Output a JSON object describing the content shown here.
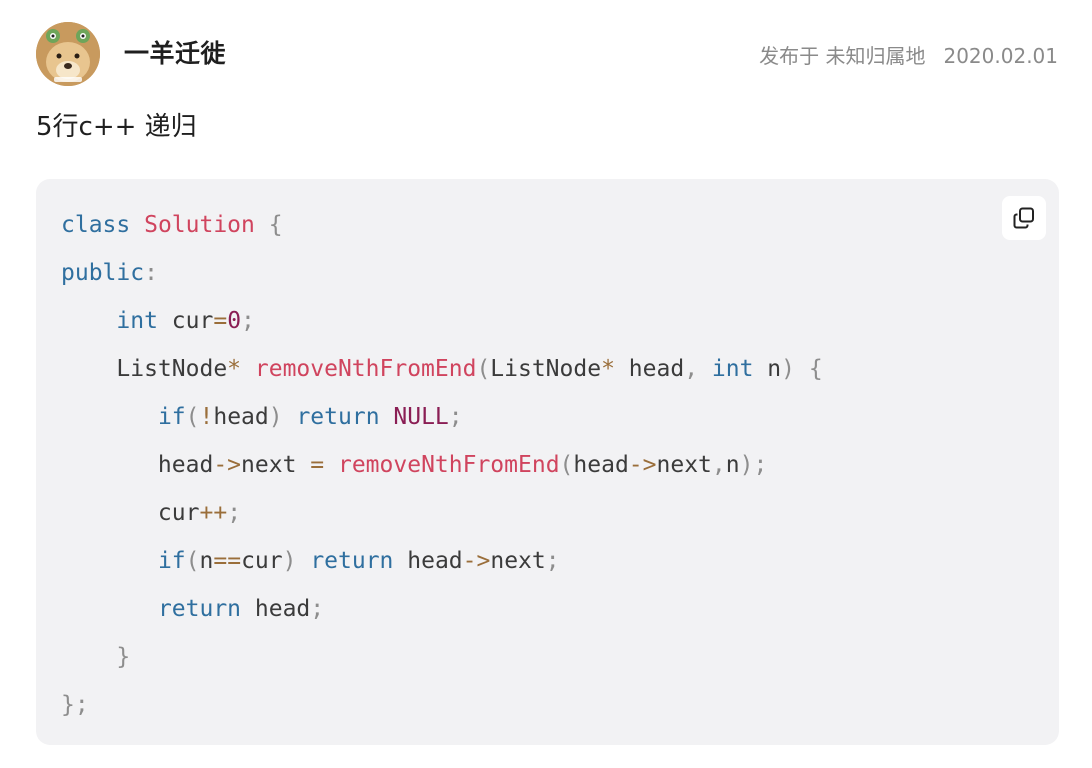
{
  "author": {
    "name": "一羊迁徙",
    "avatar": "dog-avatar-icon"
  },
  "meta": {
    "published": "发布于 未知归属地",
    "date": "2020.02.01"
  },
  "post": {
    "title": "5行c++ 递归"
  },
  "code": {
    "language": "cpp",
    "copy_icon": "copy-icon",
    "lines": [
      [
        [
          "kw",
          "class"
        ],
        [
          "",
          ""
        ],
        [
          "cls",
          " Solution"
        ],
        [
          "punc",
          " {"
        ]
      ],
      [
        [
          "kw",
          "public"
        ],
        [
          "punc",
          ":"
        ]
      ],
      [
        [
          "",
          "    "
        ],
        [
          "kw",
          "int"
        ],
        [
          "",
          " cur"
        ],
        [
          "op",
          "="
        ],
        [
          "num",
          "0"
        ],
        [
          "punc",
          ";"
        ]
      ],
      [
        [
          "",
          "    ListNode"
        ],
        [
          "op",
          "*"
        ],
        [
          "fn",
          " removeNthFromEnd"
        ],
        [
          "punc",
          "("
        ],
        [
          "",
          "ListNode"
        ],
        [
          "op",
          "*"
        ],
        [
          "",
          " head"
        ],
        [
          "punc",
          ","
        ],
        [
          "kw",
          " int"
        ],
        [
          "",
          " n"
        ],
        [
          "punc",
          ")"
        ],
        [
          "punc",
          " {"
        ]
      ],
      [
        [
          "",
          "       "
        ],
        [
          "kw",
          "if"
        ],
        [
          "punc",
          "("
        ],
        [
          "op",
          "!"
        ],
        [
          "",
          "head"
        ],
        [
          "punc",
          ")"
        ],
        [
          "kw",
          " return"
        ],
        [
          "num",
          " NULL"
        ],
        [
          "punc",
          ";"
        ]
      ],
      [
        [
          "",
          "       head"
        ],
        [
          "op",
          "->"
        ],
        [
          "",
          "next "
        ],
        [
          "op",
          "="
        ],
        [
          "fn",
          " removeNthFromEnd"
        ],
        [
          "punc",
          "("
        ],
        [
          "",
          "head"
        ],
        [
          "op",
          "->"
        ],
        [
          "",
          "next"
        ],
        [
          "punc",
          ","
        ],
        [
          "",
          "n"
        ],
        [
          "punc",
          ")"
        ],
        [
          "punc",
          ";"
        ]
      ],
      [
        [
          "",
          "       cur"
        ],
        [
          "op",
          "++"
        ],
        [
          "punc",
          ";"
        ]
      ],
      [
        [
          "",
          "       "
        ],
        [
          "kw",
          "if"
        ],
        [
          "punc",
          "("
        ],
        [
          "",
          "n"
        ],
        [
          "op",
          "=="
        ],
        [
          "",
          "cur"
        ],
        [
          "punc",
          ")"
        ],
        [
          "kw",
          " return"
        ],
        [
          "",
          " head"
        ],
        [
          "op",
          "->"
        ],
        [
          "",
          "next"
        ],
        [
          "punc",
          ";"
        ]
      ],
      [
        [
          "",
          "       "
        ],
        [
          "kw",
          "return"
        ],
        [
          "",
          " head"
        ],
        [
          "punc",
          ";"
        ]
      ],
      [
        [
          "",
          "    "
        ],
        [
          "punc",
          "}"
        ]
      ],
      [
        [
          "punc",
          "};"
        ]
      ]
    ]
  },
  "colors": {
    "keyword": "#2f6f9f",
    "class_name": "#d0445e",
    "function": "#d0445e",
    "number": "#8a1e54",
    "operator": "#9a6e3a",
    "punctuation": "#8d8d8d",
    "text": "#3b3b3b",
    "code_bg": "#f2f2f4"
  }
}
